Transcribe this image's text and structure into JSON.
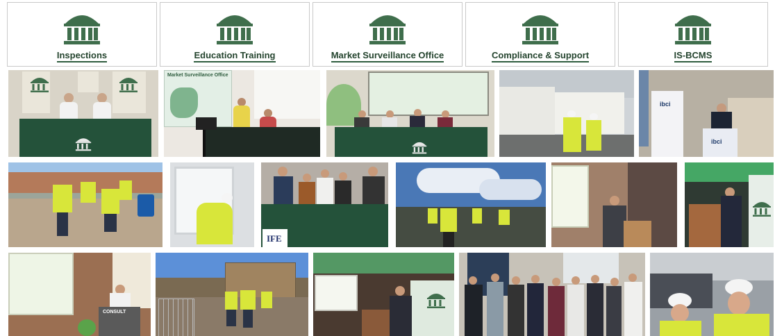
{
  "nav": {
    "items": [
      {
        "label": "Inspections",
        "icon": "building-columns-icon"
      },
      {
        "label": "Education Training",
        "icon": "building-columns-icon"
      },
      {
        "label": "Market Surveillance Office",
        "icon": "building-columns-icon"
      },
      {
        "label": "Compliance & Support",
        "icon": "building-columns-icon"
      },
      {
        "label": "IS-BCMS",
        "icon": "building-columns-icon"
      }
    ],
    "colors": {
      "brand_green": "#3f6e4c",
      "label_color": "#24442e"
    }
  },
  "gallery": {
    "captions": {
      "market_surveillance_slide": "Market Surveillance Office",
      "ibci_banner": "ibci",
      "ife_logo": "IFE",
      "conference_banner": "CONSULT"
    }
  }
}
